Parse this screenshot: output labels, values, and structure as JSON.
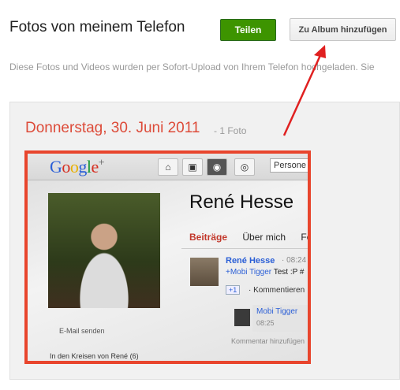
{
  "header": {
    "title": "Fotos von meinem Telefon",
    "share_label": "Teilen",
    "add_album_label": "Zu Album hinzufügen",
    "subtitle": "Diese Fotos und Videos wurden per Sofort-Upload von Ihrem Telefon hochgeladen. Sie"
  },
  "album": {
    "date": "Donnerstag, 30. Juni 2011",
    "separator": "-",
    "count": "1 Foto"
  },
  "photo": {
    "logo": {
      "letters": [
        "G",
        "o",
        "o",
        "g",
        "l",
        "e"
      ],
      "plus": "+"
    },
    "nav_icons": [
      "home-icon",
      "photos-icon",
      "profile-icon",
      "circles-icon"
    ],
    "search_text": "Persone",
    "profile_name": "René Hesse",
    "tabs": [
      "Beiträge",
      "Über mich",
      "Fo"
    ],
    "post_author": "René Hesse",
    "post_time": "· 08:24",
    "post_mention": "+Mobi Tigger",
    "post_text": "Test :P #",
    "plus_one": "+1",
    "comments_label": "· Kommentieren",
    "comment_author": "Mobi Tigger",
    "comment_time": "08:25",
    "add_comment": "Kommentar hinzufügen",
    "email_link": "E-Mail senden",
    "circles_text": "In den Kreisen von René (6)"
  },
  "colors": {
    "share_button": "#3d9400",
    "date_heading": "#dd4b39",
    "photo_frame": "#e8452d",
    "annotation_arrow": "#e02020"
  }
}
